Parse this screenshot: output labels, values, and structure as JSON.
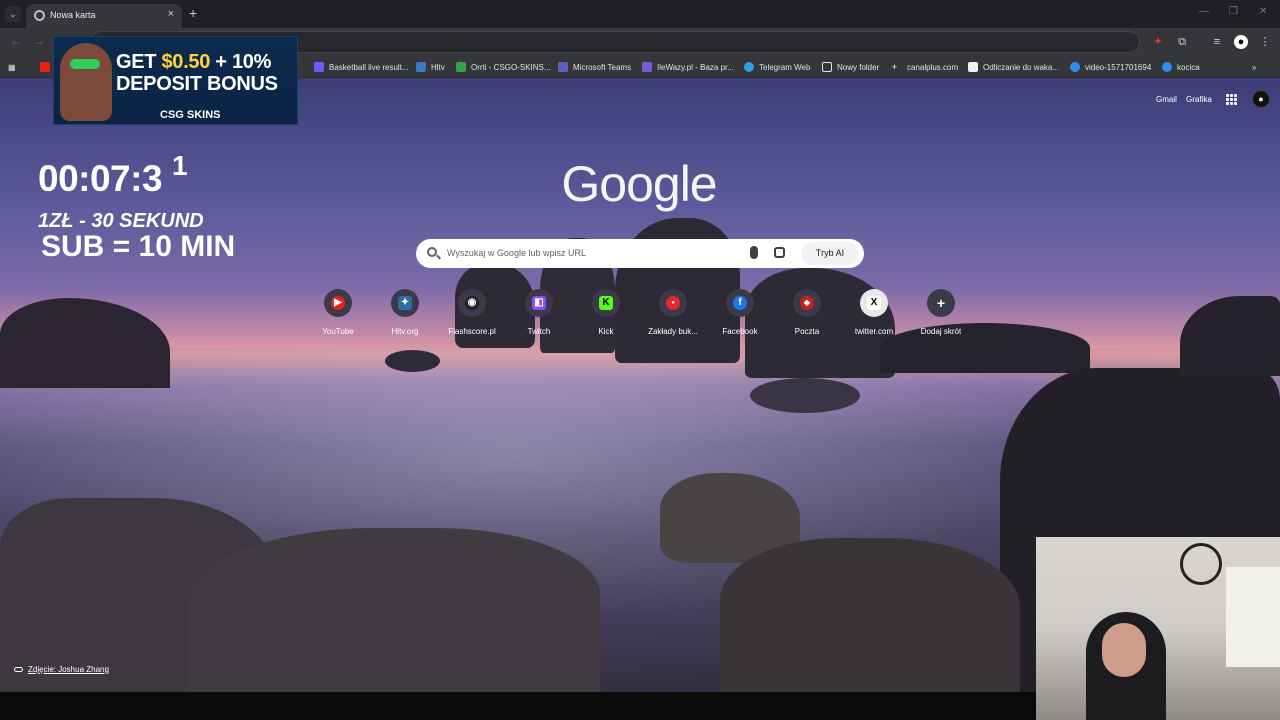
{
  "tab": {
    "title": "Nowa karta",
    "new_tab": "+",
    "close": "×",
    "dropdown": "⌄"
  },
  "toolbar": {
    "back": "←",
    "forward": "→"
  },
  "bookmarks": [
    {
      "label": "Basketball live result..."
    },
    {
      "label": "Hltv"
    },
    {
      "label": "Orrti - CSGO-SKINS..."
    },
    {
      "label": "Microsoft Teams"
    },
    {
      "label": "IleWazy.pl - Baza pr..."
    },
    {
      "label": "Telegram Web"
    },
    {
      "label": "Nowy folder"
    },
    {
      "label": "canalplus.com"
    },
    {
      "label": "Odliczanie do waka..."
    },
    {
      "label": "video-1571701694"
    },
    {
      "label": "kocica"
    }
  ],
  "bookmarks_more": "»",
  "banner": {
    "line1_prefix": "GET ",
    "line1_accent": "$0.50",
    "line1_suffix": " + 10%",
    "line2": "DEPOSIT BONUS",
    "brand": "CSG SKINS"
  },
  "stream": {
    "timer": "00:07:3",
    "timer_next": "1",
    "rate": "1ZŁ - 30 SEKUND",
    "sub": "SUB = 10 MIN"
  },
  "ntp": {
    "gmail": "Gmail",
    "images": "Grafika",
    "logo": "Google",
    "search_placeholder": "Wyszukaj w Google lub wpisz URL",
    "ai_mode": "Tryb AI",
    "credit": "Zdjęcie: Joshua Zhang"
  },
  "shortcuts": [
    {
      "label": "YouTube",
      "glyph": "▶",
      "color": "#e62117"
    },
    {
      "label": "Hltv.org",
      "glyph": "✦",
      "color": "#2d6da3"
    },
    {
      "label": "Flashscore.pl",
      "glyph": "◉",
      "color": "#222222"
    },
    {
      "label": "Twitch",
      "glyph": "◧",
      "color": "#9146ff"
    },
    {
      "label": "Kick",
      "glyph": "K",
      "color": "#53fc18"
    },
    {
      "label": "Zakłady buk...",
      "glyph": "●",
      "color": "#e3262f"
    },
    {
      "label": "Facebook",
      "glyph": "f",
      "color": "#1877f2"
    },
    {
      "label": "Poczta",
      "glyph": "◆",
      "color": "#c81e1e"
    },
    {
      "label": "twitter.com",
      "glyph": "X",
      "color": "#000000"
    },
    {
      "label": "Dodaj skrót",
      "glyph": "+",
      "color": "#3c3a4a"
    }
  ]
}
